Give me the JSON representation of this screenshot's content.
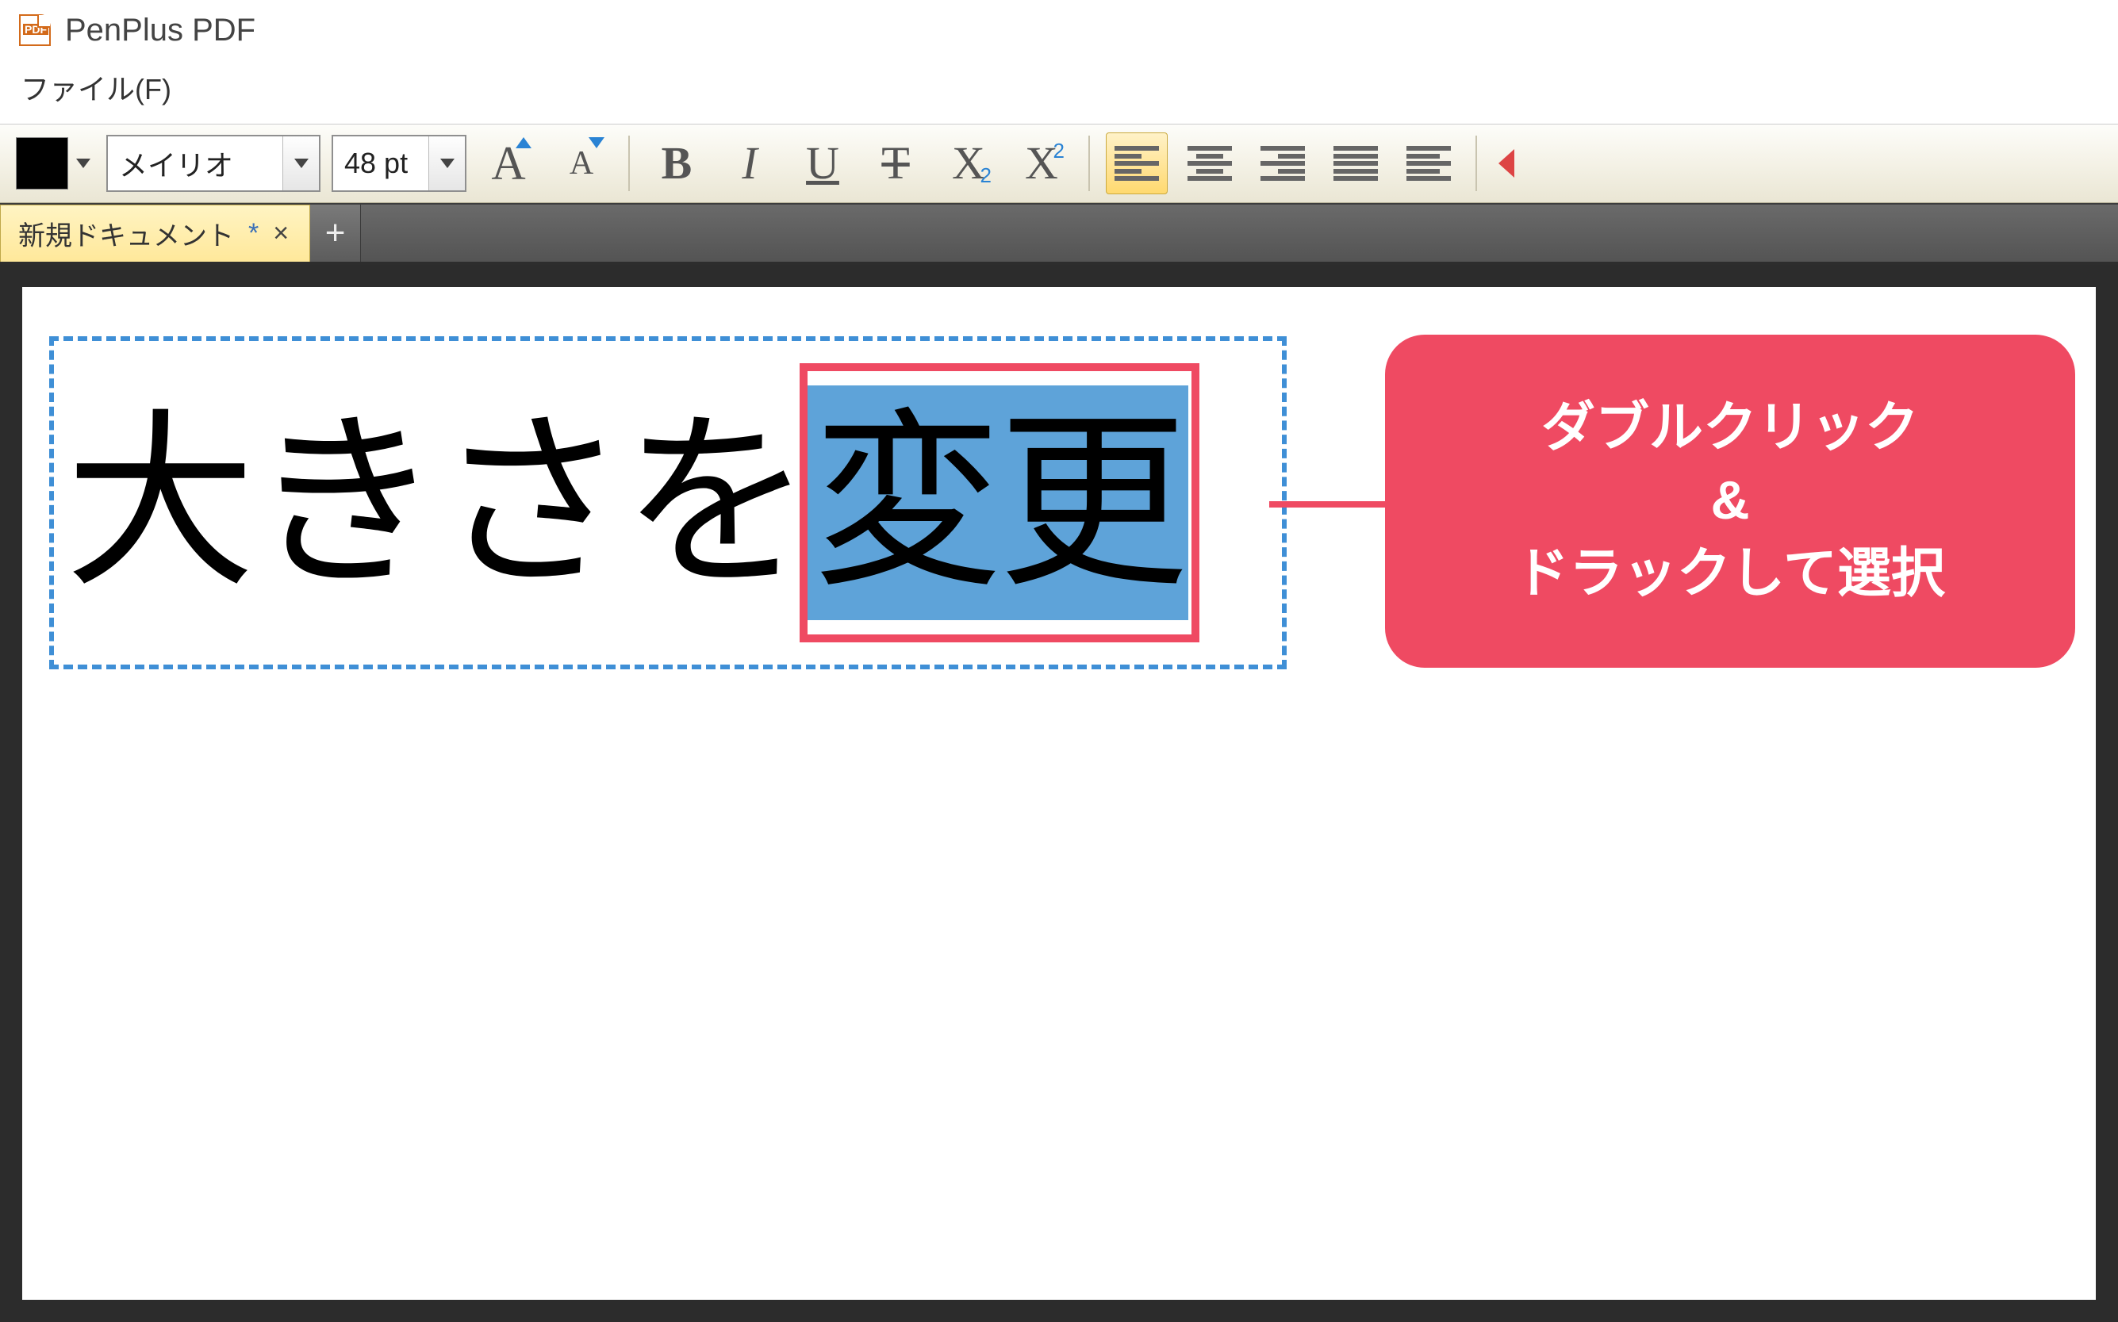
{
  "app": {
    "title": "PenPlus PDF"
  },
  "menu": {
    "file": "ファイル(F)"
  },
  "toolbar": {
    "color": "#000000",
    "font_name": "メイリオ",
    "font_size": "48 pt",
    "increase_font_glyph": "A",
    "decrease_font_glyph": "A",
    "bold_glyph": "B",
    "italic_glyph": "I",
    "underline_glyph": "U",
    "strike_glyph": "T",
    "sub_glyph": "X",
    "sub_badge": "2",
    "sup_glyph": "X",
    "sup_badge": "2"
  },
  "tabs": {
    "active_label": "新規ドキュメント",
    "modified_marker": "*",
    "close_glyph": "×",
    "add_glyph": "+"
  },
  "document": {
    "text_unselected": "大きさを",
    "text_selected": "変更"
  },
  "callout": {
    "line1": "ダブルクリック",
    "line2": "&",
    "line3": "ドラックして選択"
  }
}
